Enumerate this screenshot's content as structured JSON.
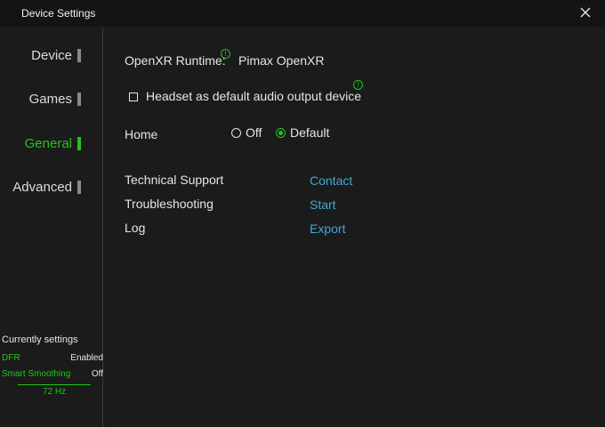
{
  "window": {
    "title": "Device Settings",
    "close_icon": "close-icon"
  },
  "sidebar": {
    "items": [
      {
        "label": "Device",
        "active": false
      },
      {
        "label": "Games",
        "active": false
      },
      {
        "label": "General",
        "active": true
      },
      {
        "label": "Advanced",
        "active": false
      }
    ],
    "current": {
      "heading": "Currently settings",
      "dfr_label": "DFR",
      "dfr_value": "Enabled",
      "smoothing_label": "Smart Smoothing",
      "smoothing_value": "Off",
      "refresh_rate": "72 Hz"
    }
  },
  "general": {
    "runtime_label": "OpenXR Runtime:",
    "runtime_value": "Pimax OpenXR",
    "audio_checkbox_label": "Headset as default audio output device",
    "audio_checked": false,
    "home_label": "Home",
    "home_options": [
      "Off",
      "Default"
    ],
    "home_selected": "Default",
    "support_label": "Technical Support",
    "support_link": "Contact",
    "troubleshooting_label": "Troubleshooting",
    "troubleshooting_link": "Start",
    "log_label": "Log",
    "log_link": "Export",
    "info_icon": "info-icon"
  },
  "colors": {
    "accent": "#22c51e",
    "link": "#3fa9d8",
    "background": "#1b1b1b",
    "titlebar": "#141414"
  }
}
